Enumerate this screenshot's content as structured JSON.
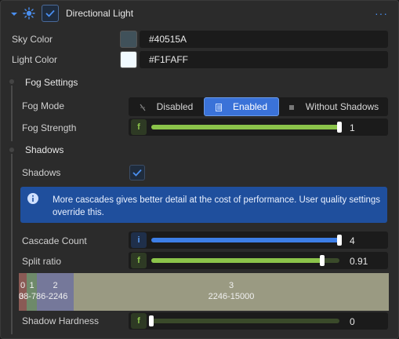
{
  "header": {
    "title": "Directional Light",
    "enabled": true
  },
  "fields": {
    "sky_color": {
      "label": "Sky Color",
      "value": "#40515A",
      "color": "#40515A"
    },
    "light_color": {
      "label": "Light Color",
      "value": "#F1FAFF",
      "color": "#F1FAFF"
    }
  },
  "fog": {
    "title": "Fog Settings",
    "mode_label": "Fog Mode",
    "modes": [
      "Disabled",
      "Enabled",
      "Without Shadows"
    ],
    "selected_mode": "Enabled",
    "strength_label": "Fog Strength",
    "strength_badge": "f",
    "strength_value": "1",
    "strength_fraction": 1.0
  },
  "shadows": {
    "title": "Shadows",
    "toggle_label": "Shadows",
    "toggle_checked": true,
    "info_text": "More cascades gives better detail at the cost of performance. User quality settings override this.",
    "cascade_count_label": "Cascade Count",
    "cascade_count_badge": "i",
    "cascade_count_value": "4",
    "cascade_count_fraction": 1.0,
    "split_ratio_label": "Split ratio",
    "split_ratio_badge": "f",
    "split_ratio_value": "0.91",
    "split_ratio_fraction": 0.91,
    "cascades": [
      {
        "index": "0",
        "range": "0-38",
        "color": "#8a5a55"
      },
      {
        "index": "1",
        "range": "38-786",
        "color": "#6e8a6a"
      },
      {
        "index": "2",
        "range": "786-2246",
        "color": "#75789a"
      },
      {
        "index": "3",
        "range": "2246-15000",
        "color": "#9a9a82"
      }
    ],
    "cascade_display": [
      "0",
      "38-786-2246",
      "2246-15000"
    ],
    "hardness_label": "Shadow Hardness",
    "hardness_badge": "f",
    "hardness_value": "0",
    "hardness_fraction": 0.0
  },
  "colors": {
    "accent": "#3a72d8",
    "green": "#8bc34a",
    "blue_slider": "#3d7ee6"
  }
}
